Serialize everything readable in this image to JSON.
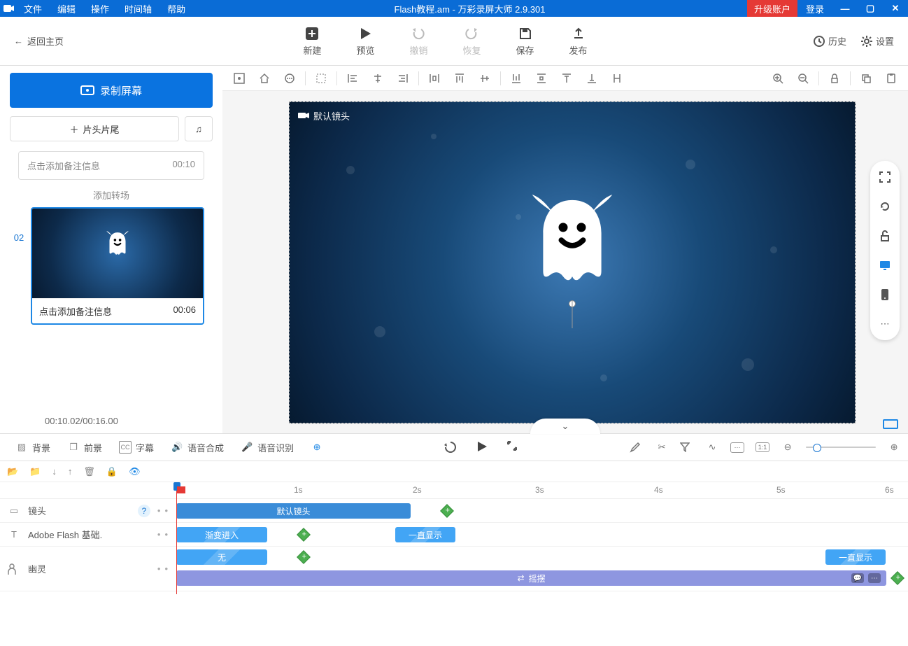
{
  "title_bar": {
    "menus": [
      "文件",
      "编辑",
      "操作",
      "时间轴",
      "帮助"
    ],
    "doc_title": "Flash教程.am - 万彩录屏大师 2.9.301",
    "upgrade": "升级账户",
    "login": "登录"
  },
  "main_toolbar": {
    "back": "返回主页",
    "buttons": [
      {
        "label": "新建"
      },
      {
        "label": "预览"
      },
      {
        "label": "撤销"
      },
      {
        "label": "恢复"
      },
      {
        "label": "保存"
      },
      {
        "label": "发布"
      }
    ],
    "right": {
      "history": "历史",
      "settings": "设置"
    }
  },
  "left_panel": {
    "record": "录制屏幕",
    "head_tail": "片头片尾",
    "scene1_note": "点击添加备注信息",
    "scene1_time": "00:10",
    "add_transition": "添加转场",
    "scene2_index": "02",
    "scene2_note": "点击添加备注信息",
    "scene2_time": "00:06",
    "time_footer": "00:10.02/00:16.00"
  },
  "stage": {
    "camera_label": "默认镜头"
  },
  "tabs_row": {
    "background": "背景",
    "foreground": "前景",
    "subtitle": "字幕",
    "tts": "语音合成",
    "asr": "语音识别"
  },
  "timeline": {
    "ruler_ticks": [
      "1s",
      "2s",
      "3s",
      "4s",
      "5s",
      "6s"
    ],
    "tracks": {
      "camera": {
        "label": "镜头",
        "clip": "默认镜头"
      },
      "text": {
        "label": "Adobe  Flash 基础.",
        "enter": "渐变进入",
        "stay": "一直显示"
      },
      "ghost": {
        "label": "幽灵",
        "enter": "无",
        "effect": "摇摆",
        "stay": "一直显示"
      }
    }
  }
}
